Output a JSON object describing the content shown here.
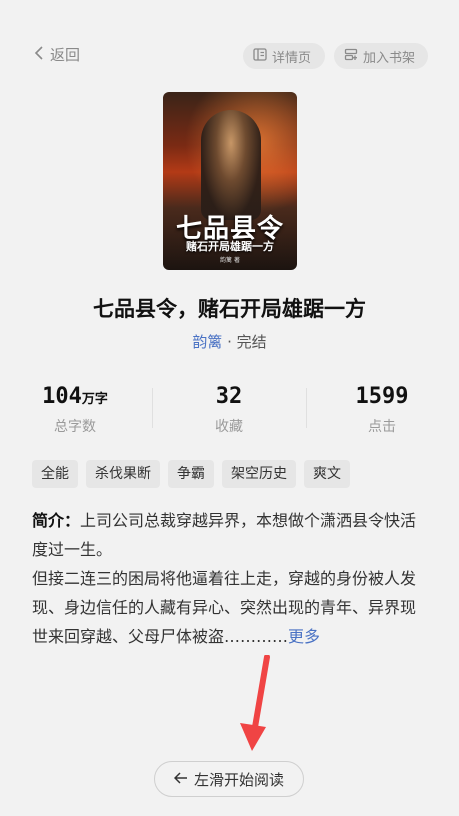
{
  "nav": {
    "back_label": "返回",
    "detail_label": "详情页",
    "shelf_label": "加入书架"
  },
  "cover": {
    "title": "七品县令",
    "subtitle": "赌石开局雄踞一方",
    "author_small": "韵篱 著"
  },
  "book": {
    "title": "七品县令，赌石开局雄踞一方",
    "author": "韵篱",
    "separator": " · ",
    "status": "完结"
  },
  "stats": [
    {
      "value": "104",
      "unit": "万字",
      "label": "总字数"
    },
    {
      "value": "32",
      "unit": "",
      "label": "收藏"
    },
    {
      "value": "1599",
      "unit": "",
      "label": "点击"
    }
  ],
  "tags": [
    "全能",
    "杀伐果断",
    "争霸",
    "架空历史",
    "爽文"
  ],
  "intro": {
    "label": "简介：",
    "line1": "上司公司总裁穿越异界，本想做个潇洒县令快活度过一生。",
    "line2": "但接二连三的困局将他逼着往上走，穿越的身份被人发现、身边信任的人藏有异心、突然出现的青年、异界现世来回穿越、父母尸体被盗…………",
    "more": "更多"
  },
  "start_button": {
    "label": "左滑开始阅读"
  },
  "colors": {
    "accent": "#4a72c4",
    "arrow": "#f04444",
    "background": "#f2f2f2"
  }
}
